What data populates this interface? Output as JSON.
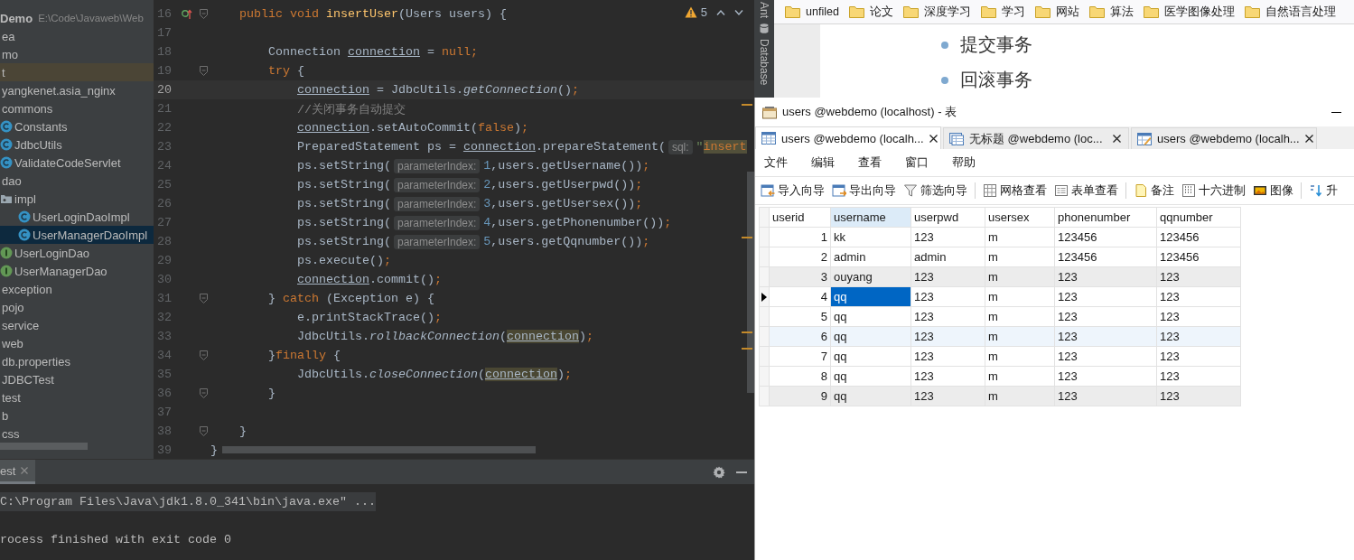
{
  "ide": {
    "project": {
      "root_name": "Demo",
      "root_path": "E:\\Code\\Javaweb\\Web",
      "items": [
        {
          "label": "ea",
          "selected": false,
          "highlighted": false
        },
        {
          "label": "mo",
          "selected": false,
          "highlighted": false
        },
        {
          "label": "t",
          "selected": false,
          "highlighted": true
        },
        {
          "label": "yangkenet.asia_nginx",
          "selected": false,
          "highlighted": false
        },
        {
          "label": "commons",
          "selected": false,
          "highlighted": false,
          "children": [
            {
              "label": "Constants",
              "kind": "class",
              "selected": false,
              "highlighted": false
            },
            {
              "label": "JdbcUtils",
              "kind": "class",
              "selected": false,
              "highlighted": false
            },
            {
              "label": "ValidateCodeServlet",
              "kind": "class",
              "selected": false,
              "highlighted": false
            }
          ]
        },
        {
          "label": "dao",
          "selected": false,
          "highlighted": false,
          "children": [
            {
              "label": "impl",
              "kind": "package",
              "selected": false,
              "highlighted": false,
              "children": [
                {
                  "label": "UserLoginDaoImpl",
                  "kind": "class",
                  "selected": false,
                  "highlighted": false
                },
                {
                  "label": "UserManagerDaoImpl",
                  "kind": "class",
                  "selected": true,
                  "highlighted": false
                }
              ]
            },
            {
              "label": "UserLoginDao",
              "kind": "interface",
              "selected": false,
              "highlighted": false
            },
            {
              "label": "UserManagerDao",
              "kind": "interface",
              "selected": false,
              "highlighted": false
            }
          ]
        },
        {
          "label": "exception",
          "selected": false,
          "highlighted": false
        },
        {
          "label": "pojo",
          "selected": false,
          "highlighted": false
        },
        {
          "label": "service",
          "selected": false,
          "highlighted": false
        },
        {
          "label": "web",
          "selected": false,
          "highlighted": false
        },
        {
          "label": "db.properties",
          "selected": false,
          "highlighted": false
        },
        {
          "label": "JDBCTest",
          "selected": false,
          "highlighted": false
        },
        {
          "label": "test",
          "selected": false,
          "highlighted": false
        },
        {
          "label": "b",
          "selected": false,
          "highlighted": false
        },
        {
          "label": "css",
          "selected": false,
          "highlighted": false
        }
      ]
    },
    "editor": {
      "problems": "5",
      "lines": [
        {
          "number": "16",
          "current": false,
          "fold": true,
          "override": true,
          "tokens": [
            {
              "kind": "keyword",
              "text": "    public void "
            },
            {
              "kind": "decl",
              "text": "insertUser"
            },
            {
              "kind": "plain",
              "text": "(Users users) {"
            }
          ]
        },
        {
          "number": "17",
          "current": false,
          "fold": false,
          "override": false
        },
        {
          "number": "18",
          "current": false,
          "fold": false,
          "override": false,
          "tokens": [
            {
              "kind": "plain",
              "text": "        Connection "
            },
            {
              "kind": "var",
              "text": "connection"
            },
            {
              "kind": "plain",
              "text": " = "
            },
            {
              "kind": "keyword",
              "text": "null;"
            }
          ]
        },
        {
          "number": "19",
          "current": false,
          "fold": true,
          "override": false,
          "tokens": [
            {
              "kind": "keyword",
              "text": "        try"
            },
            {
              "kind": "plain",
              "text": " {"
            }
          ]
        },
        {
          "number": "20",
          "current": true,
          "fold": false,
          "override": false,
          "tokens": [
            {
              "kind": "var",
              "text": "            connection"
            },
            {
              "kind": "plain",
              "text": " = JdbcUtils."
            },
            {
              "kind": "call",
              "text": "getConnection"
            },
            {
              "kind": "plain",
              "text": "()"
            },
            {
              "kind": "keyword",
              "text": ";"
            }
          ]
        },
        {
          "number": "21",
          "current": false,
          "fold": false,
          "override": false,
          "tokens": [
            {
              "kind": "comment",
              "text": "            //关闭事务自动提交"
            }
          ]
        },
        {
          "number": "22",
          "current": false,
          "fold": false,
          "override": false,
          "tokens": [
            {
              "kind": "var",
              "text": "            connection"
            },
            {
              "kind": "plain",
              "text": ".setAutoCommit("
            },
            {
              "kind": "keyword",
              "text": "false"
            },
            {
              "kind": "plain",
              "text": ")"
            },
            {
              "kind": "keyword",
              "text": ";"
            }
          ]
        },
        {
          "number": "23",
          "current": false,
          "fold": false,
          "override": false,
          "tokens": [
            {
              "kind": "plain",
              "text": "            PreparedStatement ps = "
            },
            {
              "kind": "var",
              "text": "connection"
            },
            {
              "kind": "plain",
              "text": ".prepareStatement("
            },
            {
              "kind": "hint",
              "text": "sql:"
            },
            {
              "kind": "string",
              "text": "\""
            },
            {
              "kind": "match",
              "text": "insert"
            }
          ]
        },
        {
          "number": "24",
          "current": false,
          "fold": false,
          "override": false,
          "tokens": [
            {
              "kind": "plain",
              "text": "            ps.setString("
            },
            {
              "kind": "hint",
              "text": "parameterIndex:"
            },
            {
              "kind": "number",
              "text": "1"
            },
            {
              "kind": "plain",
              "text": ",users.getUsername())"
            },
            {
              "kind": "keyword",
              "text": ";"
            }
          ]
        },
        {
          "number": "25",
          "current": false,
          "fold": false,
          "override": false,
          "tokens": [
            {
              "kind": "plain",
              "text": "            ps.setString("
            },
            {
              "kind": "hint",
              "text": "parameterIndex:"
            },
            {
              "kind": "number",
              "text": "2"
            },
            {
              "kind": "plain",
              "text": ",users.getUserpwd())"
            },
            {
              "kind": "keyword",
              "text": ";"
            }
          ]
        },
        {
          "number": "26",
          "current": false,
          "fold": false,
          "override": false,
          "tokens": [
            {
              "kind": "plain",
              "text": "            ps.setString("
            },
            {
              "kind": "hint",
              "text": "parameterIndex:"
            },
            {
              "kind": "number",
              "text": "3"
            },
            {
              "kind": "plain",
              "text": ",users.getUsersex())"
            },
            {
              "kind": "keyword",
              "text": ";"
            }
          ]
        },
        {
          "number": "27",
          "current": false,
          "fold": false,
          "override": false,
          "tokens": [
            {
              "kind": "plain",
              "text": "            ps.setString("
            },
            {
              "kind": "hint",
              "text": "parameterIndex:"
            },
            {
              "kind": "number",
              "text": "4"
            },
            {
              "kind": "plain",
              "text": ",users.getPhonenumber())"
            },
            {
              "kind": "keyword",
              "text": ";"
            }
          ]
        },
        {
          "number": "28",
          "current": false,
          "fold": false,
          "override": false,
          "tokens": [
            {
              "kind": "plain",
              "text": "            ps.setString("
            },
            {
              "kind": "hint",
              "text": "parameterIndex:"
            },
            {
              "kind": "number",
              "text": "5"
            },
            {
              "kind": "plain",
              "text": ",users.getQqnumber())"
            },
            {
              "kind": "keyword",
              "text": ";"
            }
          ]
        },
        {
          "number": "29",
          "current": false,
          "fold": false,
          "override": false,
          "tokens": [
            {
              "kind": "plain",
              "text": "            ps.execute()"
            },
            {
              "kind": "keyword",
              "text": ";"
            }
          ]
        },
        {
          "number": "30",
          "current": false,
          "fold": false,
          "override": false,
          "tokens": [
            {
              "kind": "var",
              "text": "            connection"
            },
            {
              "kind": "plain",
              "text": ".commit()"
            },
            {
              "kind": "keyword",
              "text": ";"
            }
          ]
        },
        {
          "number": "31",
          "current": false,
          "fold": true,
          "override": false,
          "tokens": [
            {
              "kind": "plain",
              "text": "        } "
            },
            {
              "kind": "keyword",
              "text": "catch"
            },
            {
              "kind": "plain",
              "text": " (Exception e) {"
            }
          ]
        },
        {
          "number": "32",
          "current": false,
          "fold": false,
          "override": false,
          "tokens": [
            {
              "kind": "plain",
              "text": "            e.printStackTrace()"
            },
            {
              "kind": "keyword",
              "text": ";"
            }
          ]
        },
        {
          "number": "33",
          "current": false,
          "fold": false,
          "override": false,
          "tokens": [
            {
              "kind": "plain",
              "text": "            JdbcUtils."
            },
            {
              "kind": "call",
              "text": "rollbackConnection"
            },
            {
              "kind": "plain",
              "text": "("
            },
            {
              "kind": "ref",
              "text": "connection"
            },
            {
              "kind": "plain",
              "text": ")"
            },
            {
              "kind": "keyword",
              "text": ";"
            }
          ]
        },
        {
          "number": "34",
          "current": false,
          "fold": true,
          "override": false,
          "tokens": [
            {
              "kind": "plain",
              "text": "        }"
            },
            {
              "kind": "keyword",
              "text": "finally"
            },
            {
              "kind": "plain",
              "text": " {"
            }
          ]
        },
        {
          "number": "35",
          "current": false,
          "fold": false,
          "override": false,
          "tokens": [
            {
              "kind": "plain",
              "text": "            JdbcUtils."
            },
            {
              "kind": "call",
              "text": "closeConnection"
            },
            {
              "kind": "plain",
              "text": "("
            },
            {
              "kind": "ref",
              "text": "connection"
            },
            {
              "kind": "plain",
              "text": ")"
            },
            {
              "kind": "keyword",
              "text": ";"
            }
          ]
        },
        {
          "number": "36",
          "current": false,
          "fold": true,
          "override": false,
          "tokens": [
            {
              "kind": "plain",
              "text": "        }"
            }
          ]
        },
        {
          "number": "37",
          "current": false,
          "fold": false,
          "override": false
        },
        {
          "number": "38",
          "current": false,
          "fold": true,
          "override": false,
          "tokens": [
            {
              "kind": "plain",
              "text": "    }"
            }
          ]
        },
        {
          "number": "39",
          "current": false,
          "fold": false,
          "override": false,
          "tokens": [
            {
              "kind": "plain",
              "text": "}"
            }
          ]
        }
      ]
    },
    "run": {
      "tab": "est",
      "console": [
        {
          "text": "C:\\Program Files\\Java\\jdk1.8.0_341\\bin\\java.exe\" ...",
          "highlighted": true
        },
        {
          "text": "rocess finished with exit code 0",
          "highlighted": false
        }
      ]
    }
  },
  "browser": {
    "tool_strip": [
      "Ant",
      "Database"
    ],
    "bookmarks": [
      "unfiled",
      "论文",
      "深度学习",
      "学习",
      "网站",
      "算法",
      "医学图像处理",
      "自然语言处理"
    ],
    "bullets": [
      "提交事务",
      "回滚事务"
    ]
  },
  "navicat": {
    "title": "users @webdemo (localhost) - 表",
    "tabs": [
      {
        "label": "users @webdemo (localh...",
        "selected": true,
        "kind": "table"
      },
      {
        "label": "无标题 @webdemo (loc...",
        "selected": false,
        "kind": "query"
      },
      {
        "label": "users @webdemo (localh...",
        "selected": false,
        "kind": "design"
      }
    ],
    "menu": [
      "文件",
      "编辑",
      "查看",
      "窗口",
      "帮助"
    ],
    "toolbar": [
      [
        {
          "label": "导入向导",
          "kind": "import"
        },
        {
          "label": "导出向导",
          "kind": "export"
        },
        {
          "label": "筛选向导",
          "kind": "filter"
        }
      ],
      [
        {
          "label": "网格查看",
          "kind": "grid"
        },
        {
          "label": "表单查看",
          "kind": "form"
        }
      ],
      [
        {
          "label": "备注",
          "kind": "note"
        },
        {
          "label": "十六进制",
          "kind": "hex"
        },
        {
          "label": "图像",
          "kind": "image"
        }
      ],
      [
        {
          "label": "升",
          "kind": "sort"
        }
      ]
    ],
    "table": {
      "columns": [
        {
          "label": "userid",
          "selected": false
        },
        {
          "label": "username",
          "selected": true
        },
        {
          "label": "userpwd",
          "selected": false
        },
        {
          "label": "usersex",
          "selected": false
        },
        {
          "label": "phonenumber",
          "selected": false
        },
        {
          "label": "qqnumber",
          "selected": false
        }
      ],
      "rows": [
        {
          "selected": false,
          "color": "#ffffff",
          "cells": [
            "1",
            "kk",
            "123",
            "m",
            "123456",
            "123456"
          ]
        },
        {
          "selected": false,
          "color": "#ffffff",
          "cells": [
            "2",
            "admin",
            "admin",
            "m",
            "123456",
            "123456"
          ]
        },
        {
          "selected": false,
          "color": "#ececec",
          "cells": [
            "3",
            "ouyang",
            "123",
            "m",
            "123",
            "123"
          ]
        },
        {
          "selected": true,
          "color": "#ffffff",
          "cells": [
            "4",
            "qq",
            "123",
            "m",
            "123",
            "123"
          ]
        },
        {
          "selected": false,
          "color": "#ffffff",
          "cells": [
            "5",
            "qq",
            "123",
            "m",
            "123",
            "123"
          ]
        },
        {
          "selected": false,
          "color": "#eef5fc",
          "cells": [
            "6",
            "qq",
            "123",
            "m",
            "123",
            "123"
          ]
        },
        {
          "selected": false,
          "color": "#ffffff",
          "cells": [
            "7",
            "qq",
            "123",
            "m",
            "123",
            "123"
          ]
        },
        {
          "selected": false,
          "color": "#ffffff",
          "cells": [
            "8",
            "qq",
            "123",
            "m",
            "123",
            "123"
          ]
        },
        {
          "selected": false,
          "color": "#ececec",
          "cells": [
            "9",
            "qq",
            "123",
            "m",
            "123",
            "123"
          ]
        }
      ]
    }
  }
}
